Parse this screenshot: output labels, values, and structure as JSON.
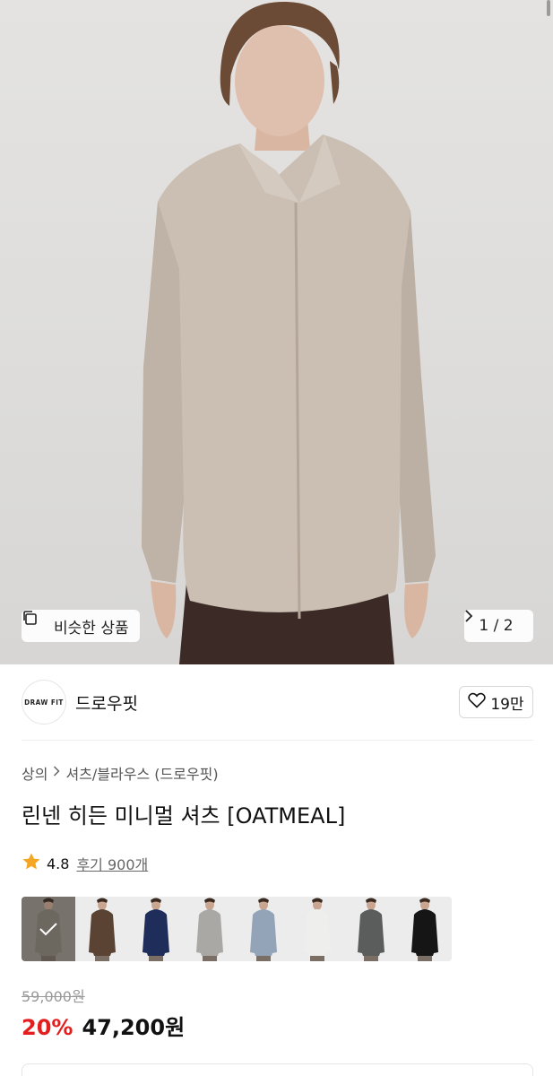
{
  "hero": {
    "similar_label": "비슷한 상품",
    "pager_text": "1 / 2",
    "similar_icon": "copy-icon",
    "next_icon": "chevron-right-icon"
  },
  "brand": {
    "logo_text": "DRAW FIT",
    "name": "드로우핏",
    "like_count": "19만",
    "like_icon": "heart-outline-icon"
  },
  "breadcrumb": {
    "items": [
      "상의",
      "셔츠/블라우스 (드로우핏)"
    ],
    "separator_icon": "chevron-right-icon"
  },
  "product": {
    "title": "린넨 히든 미니멀 셔츠 [OATMEAL]",
    "rating": "4.8",
    "reviews": "후기 900개",
    "star_color": "#f5a623"
  },
  "swatches": [
    {
      "color": "#8a8478",
      "selected": true
    },
    {
      "color": "#5a4333",
      "selected": false
    },
    {
      "color": "#1f2d5a",
      "selected": false
    },
    {
      "color": "#a9a8a5",
      "selected": false
    },
    {
      "color": "#93a4b8",
      "selected": false
    },
    {
      "color": "#eeeeec",
      "selected": false
    },
    {
      "color": "#5b5d5d",
      "selected": false
    },
    {
      "color": "#151515",
      "selected": false
    }
  ],
  "price": {
    "original": "59,000원",
    "discount": "20%",
    "sale": "47,200원",
    "discount_color": "#e31e1e"
  }
}
